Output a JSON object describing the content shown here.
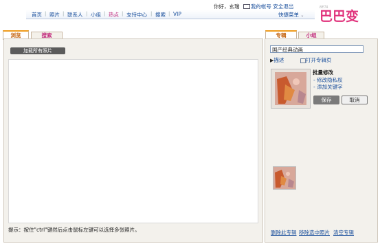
{
  "header": {
    "greeting": "你好，玄瑞",
    "my_account": "我的帐号",
    "logout": "安全退出",
    "shortcut": "快捷菜单",
    "logo_text": "巴巴变",
    "logo_beta": "BETA"
  },
  "nav": {
    "items": [
      "首页",
      "照片",
      "联系人",
      "小组",
      "热点",
      "支持中心",
      "搜索",
      "VIP"
    ]
  },
  "left": {
    "tabs": [
      "浏览",
      "搜索"
    ],
    "load_all": "加载所有照片",
    "hint": "提示：按住\"ctrl\"键然后点击鼠标左键可以选择多张照片。"
  },
  "right": {
    "tabs": [
      "专辑",
      "小组"
    ],
    "album_name": "国产经典动画",
    "describe": "描述",
    "open_album_page": "打开专辑页",
    "batch_title": "批量修改",
    "batch_links": [
      "修改隐私权",
      "添加关键字"
    ],
    "save": "保存",
    "cancel": "取消",
    "bottom_links": [
      "删除此专辑",
      "移除选中照片",
      "清空专辑"
    ]
  },
  "colors": {
    "accent_orange": "#ef9b1b",
    "link_blue": "#1a4f9c",
    "hot_pink": "#c0277a",
    "logo_pink": "#e0307a"
  }
}
